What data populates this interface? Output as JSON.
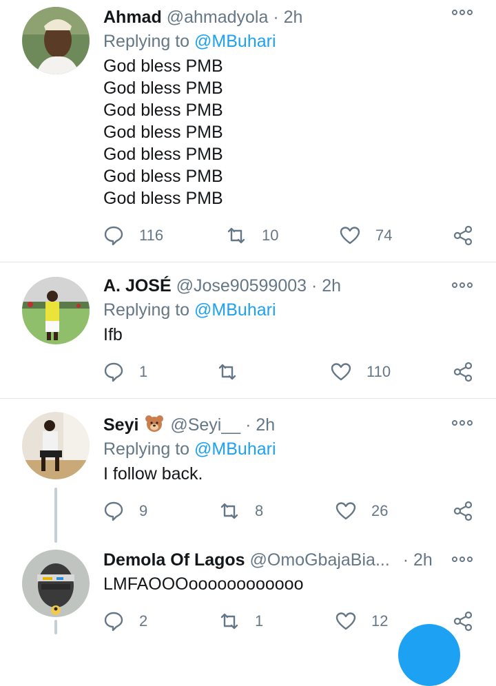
{
  "tweets": [
    {
      "name": "Ahmad",
      "handle": "@ahmadyola",
      "dot": "·",
      "time": "2h",
      "replying_prefix": "Replying to",
      "replying_to": "@MBuhari",
      "lines": [
        "God bless PMB",
        "God bless PMB",
        "God bless PMB",
        "God bless PMB",
        "God bless PMB",
        "God bless PMB",
        "God bless PMB"
      ],
      "replies": "116",
      "retweets": "10",
      "likes": "74"
    },
    {
      "name": "A. JOSÉ",
      "handle": "@Jose90599003",
      "dot": "·",
      "time": "2h",
      "replying_prefix": "Replying to",
      "replying_to": "@MBuhari",
      "lines": [
        "Ifb"
      ],
      "replies": "1",
      "retweets": "",
      "likes": "110"
    },
    {
      "name": "Seyi",
      "handle": "@Seyi__",
      "dot": "·",
      "time": "2h",
      "replying_prefix": "Replying to",
      "replying_to": "@MBuhari",
      "lines": [
        "I follow back."
      ],
      "replies": "9",
      "retweets": "8",
      "likes": "26"
    },
    {
      "name": "Demola Of Lagos",
      "handle": "@OmoGbajaBia...",
      "dot": "·",
      "time": "2h",
      "lines": [
        "LMFAOOOoooooooooooo"
      ],
      "replies": "2",
      "retweets": "1",
      "likes": "12"
    }
  ],
  "icons": {
    "reply": "reply-icon",
    "retweet": "retweet-icon",
    "like": "heart-icon",
    "share": "share-icon",
    "more": "more-options-icon",
    "emoji_seyi": "bear-face-emoji"
  },
  "colors": {
    "text": "#14171a",
    "muted": "#657786",
    "link": "#1da1f2",
    "divider": "#e1e8ed"
  }
}
